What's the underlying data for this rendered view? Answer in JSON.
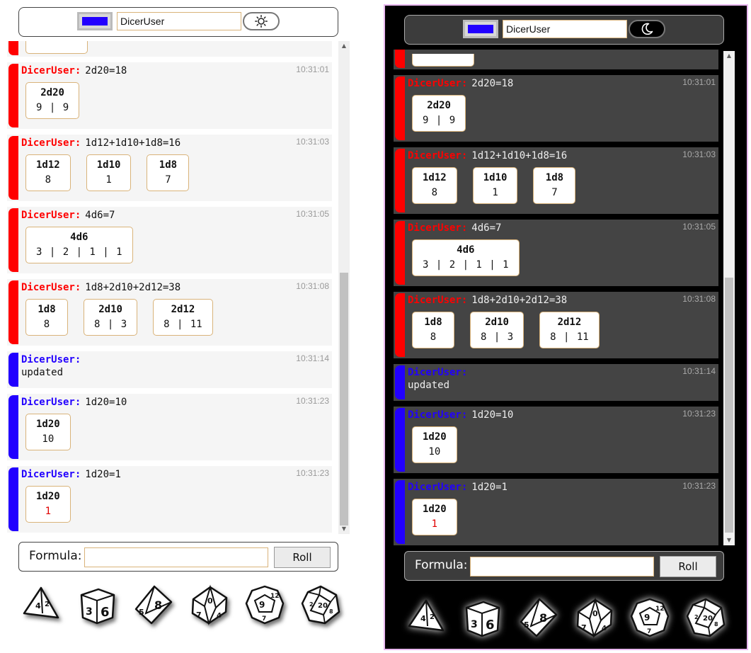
{
  "user": {
    "name": "DicerUser",
    "color": "#2200ff"
  },
  "theme_icons": {
    "light": "sun-icon",
    "dark": "moon-icon"
  },
  "colors": {
    "red_user": "#ff0000",
    "blue_user": "#2200ff",
    "crit": "#e00000"
  },
  "messages": [
    {
      "user": "DicerUser:",
      "text": "2d20=18",
      "time": "10:31:01",
      "color": "red",
      "dice": [
        {
          "title": "2d20",
          "values": "9 | 9"
        }
      ]
    },
    {
      "user": "DicerUser:",
      "text": "1d12+1d10+1d8=16",
      "time": "10:31:03",
      "color": "red",
      "dice": [
        {
          "title": "1d12",
          "values": "8"
        },
        {
          "title": "1d10",
          "values": "1"
        },
        {
          "title": "1d8",
          "values": "7"
        }
      ]
    },
    {
      "user": "DicerUser:",
      "text": "4d6=7",
      "time": "10:31:05",
      "color": "red",
      "dice": [
        {
          "title": "4d6",
          "values": "3 | 2 | 1 | 1"
        }
      ]
    },
    {
      "user": "DicerUser:",
      "text": "1d8+2d10+2d12=38",
      "time": "10:31:08",
      "color": "red",
      "dice": [
        {
          "title": "1d8",
          "values": "8"
        },
        {
          "title": "2d10",
          "values": "8 | 3"
        },
        {
          "title": "2d12",
          "values": "8 | 11"
        }
      ]
    },
    {
      "user": "DicerUser:",
      "text": "",
      "note": "updated",
      "time": "10:31:14",
      "color": "blue",
      "dice": []
    },
    {
      "user": "DicerUser:",
      "text": "1d20=10",
      "time": "10:31:23",
      "color": "blue",
      "dice": [
        {
          "title": "1d20",
          "values": "10"
        }
      ]
    },
    {
      "user": "DicerUser:",
      "text": "1d20=1",
      "time": "10:31:23",
      "color": "blue",
      "dice": [
        {
          "title": "1d20",
          "values": "1",
          "crit": true
        }
      ]
    }
  ],
  "formula": {
    "label": "Formula:",
    "value": "",
    "roll_label": "Roll"
  },
  "dice_buttons": [
    {
      "name": "d4-icon",
      "label": ""
    },
    {
      "name": "d6-icon",
      "label": ""
    },
    {
      "name": "d8-icon",
      "label": ""
    },
    {
      "name": "d10-icon",
      "label": ""
    },
    {
      "name": "d12-icon",
      "label": ""
    },
    {
      "name": "d20-icon",
      "label": ""
    }
  ]
}
